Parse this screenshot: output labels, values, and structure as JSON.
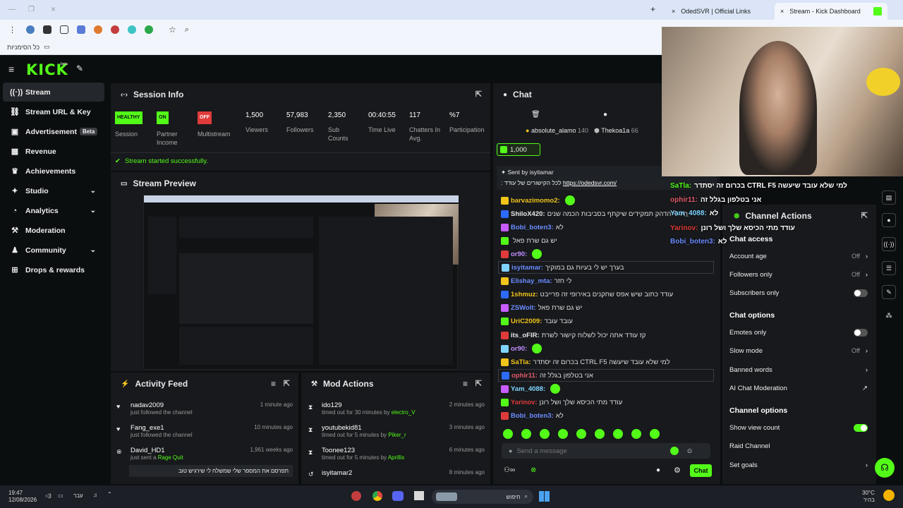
{
  "browser": {
    "tabs": [
      {
        "label": "OdedSVR | Official Links"
      },
      {
        "label": "Stream - Kick Dashboard"
      }
    ],
    "bookmarks_label": "כל הסימניות"
  },
  "app": {
    "logo": "KICK",
    "logo_sup": "beta"
  },
  "sidebar": {
    "items": [
      {
        "label": "Stream",
        "icon": "broadcast-icon"
      },
      {
        "label": "Stream URL & Key",
        "icon": "link-icon"
      },
      {
        "label": "Advertisement",
        "badge": "Beta",
        "icon": "ad-icon"
      },
      {
        "label": "Revenue",
        "icon": "revenue-icon"
      },
      {
        "label": "Achievements",
        "icon": "trophy-icon"
      },
      {
        "label": "Studio",
        "icon": "studio-icon"
      },
      {
        "label": "Analytics",
        "icon": "analytics-icon"
      },
      {
        "label": "Moderation",
        "icon": "gavel-icon"
      },
      {
        "label": "Community",
        "icon": "community-icon"
      },
      {
        "label": "Drops & rewards",
        "icon": "gift-icon"
      }
    ]
  },
  "session": {
    "title": "Session Info",
    "stats": [
      {
        "badge": "HEALTHY",
        "label": "Session",
        "color": "#53fc18"
      },
      {
        "badge": "ON",
        "label": "Partner Income",
        "color": "#53fc18"
      },
      {
        "badge": "OFF",
        "label": "Multistream",
        "color": "#e03b3b"
      },
      {
        "value": "1,500",
        "label": "Viewers"
      },
      {
        "value": "57,983",
        "label": "Followers"
      },
      {
        "value": "2,350",
        "label": "Sub Counts"
      },
      {
        "value": "00:40:55",
        "label": "Time Live"
      },
      {
        "value": "117",
        "label": "Chatters In Avg."
      },
      {
        "value": "%7",
        "label": "Participation"
      }
    ],
    "status_message": "Stream started successfully."
  },
  "preview": {
    "title": "Stream Preview"
  },
  "activity": {
    "title": "Activity Feed",
    "items": [
      {
        "name": "nadav2009",
        "text": "just followed the channel",
        "time": "1 minute ago"
      },
      {
        "name": "Fang_exe1",
        "text": "just followed the channel",
        "time": "10 minutes ago"
      },
      {
        "name": "David_HD1",
        "text": "just sent a",
        "item": "Rage Quit",
        "time": "1,961 weeks ago",
        "quote": "תפרסם את המספר שלי שמשלח לי שירגיש טוב"
      }
    ]
  },
  "mod": {
    "title": "Mod Actions",
    "items": [
      {
        "name": "ido129",
        "text": "timed out for 30 minutes by",
        "by": "electro_V",
        "time": "2 minutes ago"
      },
      {
        "name": "youtubekid81",
        "text": "timed out for 5 minutes by",
        "by": "Piker_r",
        "time": "3 minutes ago"
      },
      {
        "name": "Toonee123",
        "text": "timed out for 5 minutes by",
        "by": "Aprillix",
        "time": "6 minutes ago"
      },
      {
        "name": "isyitamar2",
        "text": "",
        "by": "",
        "time": "8 minutes ago"
      }
    ]
  },
  "chat": {
    "title": "Chat",
    "top_gifters": [
      {
        "name": "absolute_alamo",
        "count": "140"
      },
      {
        "name": "Thekoa1a",
        "count": "66"
      }
    ],
    "goal": "1,000",
    "pinned": {
      "by_label": "Sent by",
      "by": "isyitamar",
      "text": ": לכל הקישורים של עודד",
      "link": "https://odedsvr.com/"
    },
    "messages": [
      {
        "user": "barvazimomo2:",
        "text": "",
        "color": "#f0c419"
      },
      {
        "user": "ShiloX420:",
        "text": "היו לי הדהק תמקידים שיקתף בסביבות הכמה שנים",
        "color": "#e8e8e8"
      },
      {
        "user": "Bobi_boten3:",
        "text": "לא",
        "color": "#6b8cff"
      },
      {
        "user": "",
        "text": "יש גם שרת פאל",
        "color": "#e8e8e8"
      },
      {
        "user": "or90:",
        "text": "",
        "color": "#c08cff"
      },
      {
        "user": "isyitamar:",
        "text": "בערך יש לי בעיות גם במוקיך",
        "color": "#6b8cff"
      },
      {
        "user": "Elishay_mta:",
        "text": "לי חזר",
        "color": "#6b8cff"
      },
      {
        "user": "1shmuz:",
        "text": "עודד כתוב שיש אפס שחקנים באירופי זה פרייבט",
        "color": "#f0c419"
      },
      {
        "user": "ZSWolt:",
        "text": "יש גם שרת פאל",
        "color": "#6b8cff"
      },
      {
        "user": "UriC2009:",
        "text": "עובד עובד",
        "color": "#f0c419"
      },
      {
        "user": "its_oFIR:",
        "text": "קז עודד אתה יכול לשלוח קישור לשרת",
        "color": "#e8e8e8"
      },
      {
        "user": "or90:",
        "text": "",
        "color": "#c08cff"
      },
      {
        "user": "SaTla:",
        "text": "בכרום זה יסתדר CTRL F5 למי שלא עובד שיעשה",
        "color": "#f0c419"
      },
      {
        "user": "ophir11:",
        "text": "אני בטלפון בגלל זה",
        "color": "#e05a6b"
      },
      {
        "user": "Yam_4088:",
        "text": "",
        "color": "#7fd4ff"
      },
      {
        "user": "Yarinov:",
        "text": "עודד מתי הכיסא שלך ושל רונן",
        "color": "#e03b3b"
      },
      {
        "user": "Bobi_boten3:",
        "text": "לא",
        "color": "#6b8cff"
      }
    ],
    "input_placeholder": "Send a message",
    "send_label": "Chat"
  },
  "channel_actions": {
    "title": "Channel Actions",
    "overlay_lines": [
      {
        "user": "SaTla:",
        "text": "בכרום זה יסתדר CTRL F5 למי שלא עובד שיעשה"
      },
      {
        "user": "ophir11:",
        "text": "אני בטלפון בגלל זה"
      },
      {
        "user": "Yam_4088:",
        "text": "לא"
      },
      {
        "user": "Yarinov:",
        "text": "עודד מתי הכיסא שלך ושל רונן"
      },
      {
        "user": "Bobi_boten3:",
        "text": "לא"
      }
    ],
    "chat_access": "Chat access",
    "rows1": [
      {
        "label": "Account age",
        "value": "Off"
      },
      {
        "label": "Followers only",
        "value": "Off"
      },
      {
        "label": "Subscribers only",
        "toggle": false
      }
    ],
    "chat_options": "Chat options",
    "rows2": [
      {
        "label": "Emotes only",
        "toggle": false
      },
      {
        "label": "Slow mode",
        "value": "Off"
      },
      {
        "label": "Banned words",
        "value": ""
      },
      {
        "label": "AI Chat Moderation",
        "value": ""
      }
    ],
    "channel_options": "Channel options",
    "rows3": [
      {
        "label": "Show view count",
        "toggle": true
      },
      {
        "label": "Raid Channel",
        "value": ""
      },
      {
        "label": "Set goals",
        "value": ""
      }
    ]
  },
  "taskbar": {
    "time": "19:47",
    "date": "12/08/2026",
    "lang": "עבר",
    "search": "חיפוש",
    "weather_temp": "30°C",
    "weather_text": "בהיר"
  },
  "colors": {
    "accent": "#53fc18",
    "bg": "#0b0e0f",
    "panel": "#17191c"
  }
}
